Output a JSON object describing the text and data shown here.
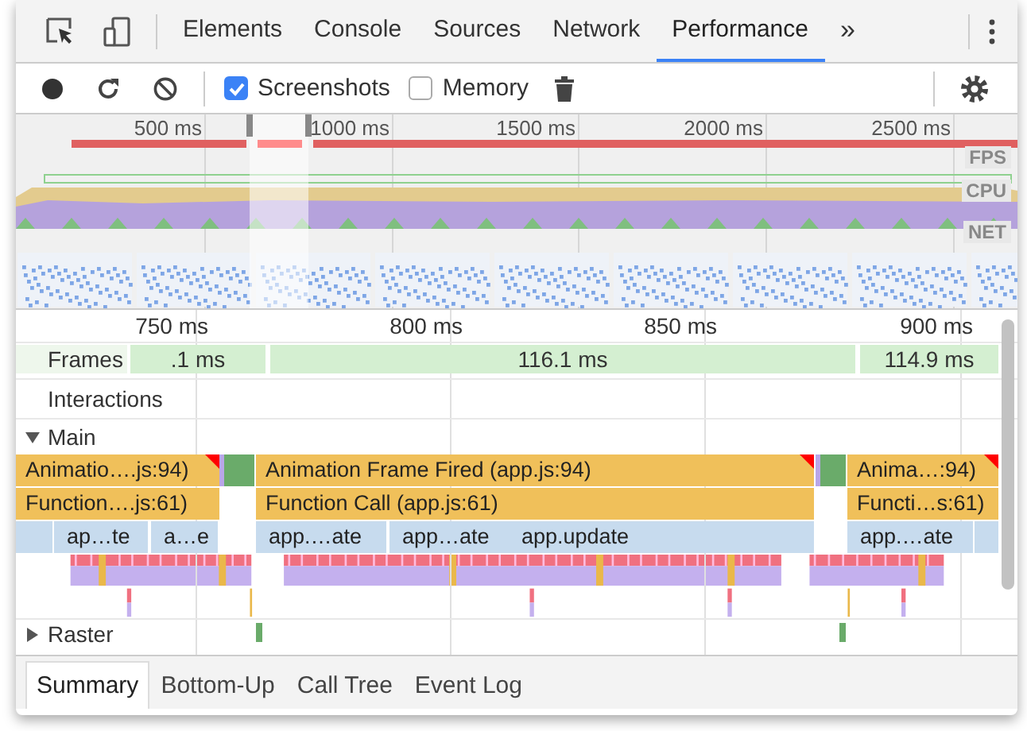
{
  "tabs": [
    {
      "label": "Elements",
      "selected": false
    },
    {
      "label": "Console",
      "selected": false
    },
    {
      "label": "Sources",
      "selected": false
    },
    {
      "label": "Network",
      "selected": false
    },
    {
      "label": "Performance",
      "selected": true
    }
  ],
  "more_tabs": "»",
  "toolbar": {
    "checkboxes": [
      {
        "label": "Screenshots",
        "checked": true
      },
      {
        "label": "Memory",
        "checked": false
      }
    ]
  },
  "overview": {
    "ruler": [
      "500 ms",
      "1000 ms",
      "1500 ms",
      "2000 ms",
      "2500 ms"
    ],
    "tracks": [
      "FPS",
      "CPU",
      "NET"
    ]
  },
  "timeline": {
    "ruler": [
      "750 ms",
      "800 ms",
      "850 ms",
      "900 ms"
    ],
    "frames": {
      "label": "Frames",
      "items": [
        ".1 ms",
        "116.1 ms",
        "114.9 ms"
      ]
    },
    "interactions": "Interactions",
    "main": {
      "label": "Main",
      "expanded": true,
      "rows": [
        {
          "blocks": [
            {
              "label": "Animatio….js:94)"
            },
            {
              "label": "Animation Frame Fired (app.js:94)"
            },
            {
              "label": "Anima…:94)"
            }
          ]
        },
        {
          "blocks": [
            {
              "label": "Function….js:61)"
            },
            {
              "label": "Function Call (app.js:61)"
            },
            {
              "label": "Functi…s:61)"
            }
          ]
        },
        {
          "blocks": [
            {
              "label": "ap…te"
            },
            {
              "label": "a…e"
            },
            {
              "label": "app.…ate"
            },
            {
              "label": "app…ate"
            },
            {
              "label": "app.update"
            },
            {
              "label": "app.…ate"
            }
          ]
        }
      ]
    },
    "raster": {
      "label": "Raster",
      "expanded": false
    }
  },
  "bottom_tabs": [
    {
      "label": "Summary",
      "selected": true
    },
    {
      "label": "Bottom-Up",
      "selected": false
    },
    {
      "label": "Call Tree",
      "selected": false
    },
    {
      "label": "Event Log",
      "selected": false
    }
  ]
}
